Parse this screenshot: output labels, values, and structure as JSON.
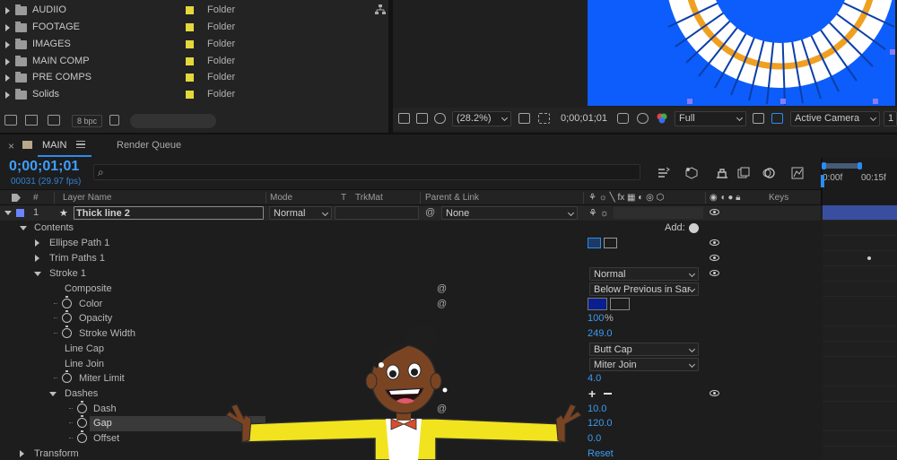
{
  "project": {
    "items": [
      {
        "name": "AUDIIO",
        "type": "Folder"
      },
      {
        "name": "FOOTAGE",
        "type": "Folder"
      },
      {
        "name": "IMAGES",
        "type": "Folder"
      },
      {
        "name": "MAIN COMP",
        "type": "Folder"
      },
      {
        "name": "PRE COMPS",
        "type": "Folder"
      },
      {
        "name": "Solids",
        "type": "Folder"
      }
    ],
    "bpc": "8 bpc"
  },
  "viewer": {
    "zoom": "(28.2%)",
    "timecode": "0;00;01;01",
    "resolution": "Full",
    "camera": "Active Camera",
    "views": "1"
  },
  "tabs": {
    "close": "×",
    "comp": "MAIN",
    "render_queue": "Render Queue"
  },
  "timeline": {
    "timecode": "0;00;01;01",
    "frames": "00031 (29.97 fps)",
    "search_placeholder": "",
    "ruler": [
      "0:00f",
      "00:15f"
    ]
  },
  "columns": {
    "num": "#",
    "layer_name": "Layer Name",
    "mode": "Mode",
    "t": "T",
    "trkmat": "TrkMat",
    "parent": "Parent & Link",
    "keys": "Keys"
  },
  "layer": {
    "index": "1",
    "name": "Thick line 2",
    "mode": "Normal",
    "parent": "None",
    "label_color": "#6c84ff"
  },
  "props": {
    "contents": "Contents",
    "add": "Add:",
    "ellipse": "Ellipse Path 1",
    "trim": "Trim Paths 1",
    "stroke": "Stroke 1",
    "stroke_mode": "Normal",
    "composite": "Composite",
    "composite_value": "Below Previous in Sar",
    "color": "Color",
    "color_value": "#0a1f8f",
    "opacity": "Opacity",
    "opacity_value": "100",
    "opacity_unit": "%",
    "stroke_width": "Stroke Width",
    "stroke_width_value": "249.0",
    "line_cap": "Line Cap",
    "line_cap_value": "Butt Cap",
    "line_join": "Line Join",
    "line_join_value": "Miter Join",
    "miter": "Miter Limit",
    "miter_value": "4.0",
    "dashes": "Dashes",
    "dash": "Dash",
    "dash_value": "10.0",
    "gap": "Gap",
    "gap_value": "120.0",
    "offset": "Offset",
    "offset_value": "0.0",
    "transform": "Transform",
    "transform_value": "Reset"
  },
  "colors": {
    "accent": "#2d8ceb",
    "comp_bg": "#0c5dfb",
    "folder_label": "#e4d83c"
  }
}
